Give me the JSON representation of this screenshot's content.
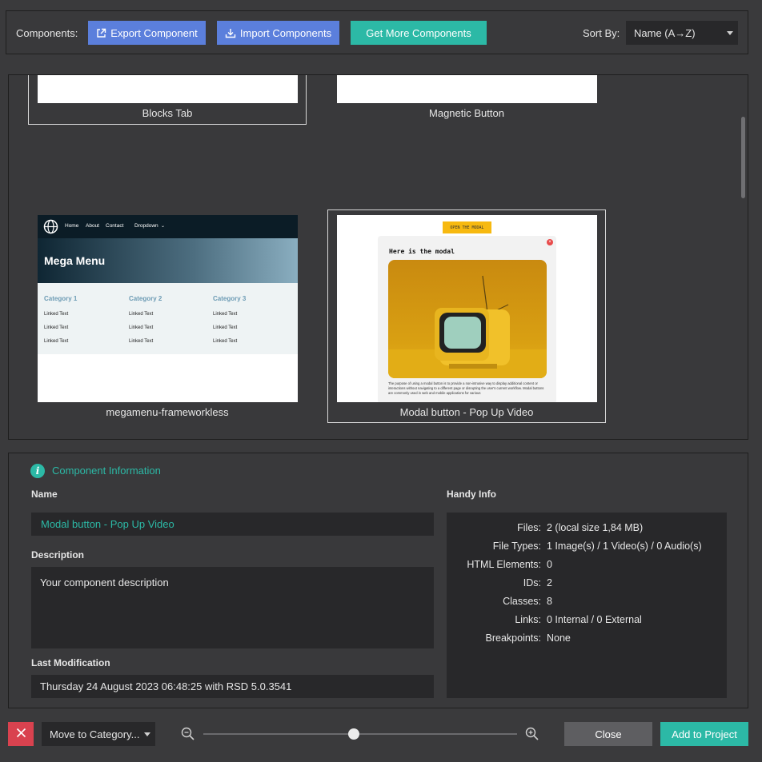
{
  "toolbar": {
    "components_label": "Components:",
    "export_label": "Export Component",
    "import_label": "Import Components",
    "get_more_label": "Get More Components",
    "sort_label": "Sort By:",
    "sort_value": "Name (A→Z)"
  },
  "gallery": {
    "cards": [
      {
        "title": "Blocks Tab"
      },
      {
        "title": "Magnetic Button"
      },
      {
        "title": "megamenu-frameworkless"
      },
      {
        "title": "Modal button - Pop Up Video"
      }
    ],
    "megamenu_preview": {
      "nav": [
        "Home",
        "About",
        "Contact",
        "Dropdown"
      ],
      "hero_title": "Mega Menu",
      "categories": [
        "Category 1",
        "Category 2",
        "Category 3"
      ],
      "link_text": "Linked Text"
    },
    "modal_preview": {
      "open_button": "OPEN THE MODAL",
      "modal_title": "Here is the modal",
      "body_text": "The purpose of using a modal button is to provide a non-intrusive way to display additional content or interactions without navigating to a different page or disrupting the user's current workflow. Modal buttons are commonly used in web and mobile applications for various"
    }
  },
  "info": {
    "heading": "Component Information",
    "name_label": "Name",
    "name_value": "Modal button - Pop Up Video",
    "description_label": "Description",
    "description_value": "Your component description",
    "last_mod_label": "Last Modification",
    "last_mod_value": "Thursday 24 August 2023 06:48:25 with RSD 5.0.3541",
    "handy_label": "Handy Info",
    "handy": [
      {
        "key": "Files:",
        "value": "2 (local size 1,84 MB)"
      },
      {
        "key": "File Types:",
        "value": "1 Image(s) / 1 Video(s) / 0 Audio(s)"
      },
      {
        "key": "HTML Elements:",
        "value": "0"
      },
      {
        "key": "IDs:",
        "value": "2"
      },
      {
        "key": "Classes:",
        "value": "8"
      },
      {
        "key": "Links:",
        "value": "0 Internal / 0 External"
      },
      {
        "key": "Breakpoints:",
        "value": "None"
      }
    ]
  },
  "bottom": {
    "move_label": "Move to Category...",
    "zoom_level": 0.48,
    "close_label": "Close",
    "add_label": "Add to Project"
  },
  "colors": {
    "accent_teal": "#2cb9a6",
    "button_blue": "#5b7fdc",
    "delete_red": "#d9424f"
  }
}
